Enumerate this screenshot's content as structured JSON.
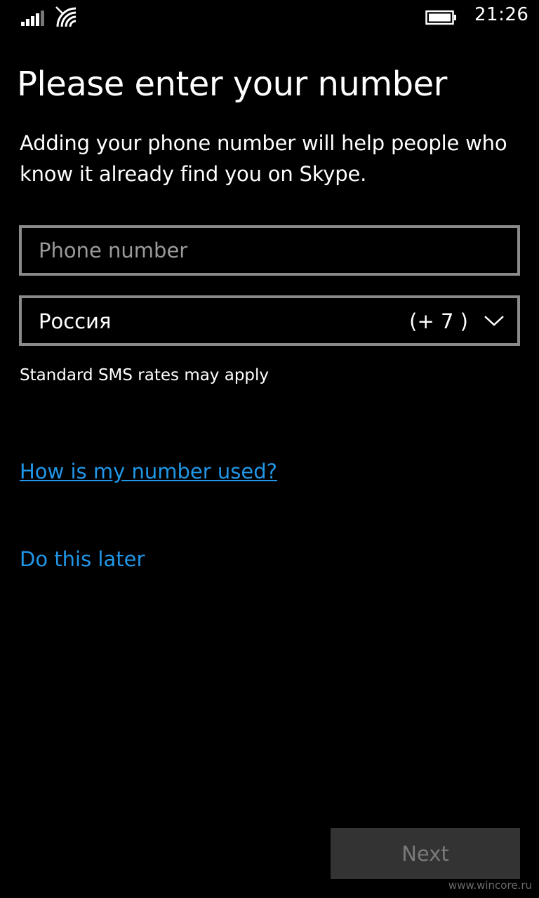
{
  "status_bar": {
    "time": "21:26",
    "icons": [
      "signal-strength-icon",
      "wifi-icon",
      "battery-icon"
    ]
  },
  "page": {
    "title": "Please enter your number",
    "description": "Adding your phone number will help people who know it already find you on Skype."
  },
  "form": {
    "phone_placeholder": "Phone number",
    "phone_value": "",
    "country_name": "Россия",
    "country_code": "(+ 7 )",
    "sms_note": "Standard SMS rates may apply"
  },
  "links": {
    "how_used": "How is my number used?",
    "do_later": "Do this later"
  },
  "actions": {
    "next_label": "Next"
  },
  "watermark": "www.wincore.ru",
  "colors": {
    "background": "#000000",
    "link": "#2196e6",
    "border": "#8a8a8a",
    "button_disabled_bg": "#333333",
    "button_disabled_text": "#7a7a7a"
  }
}
